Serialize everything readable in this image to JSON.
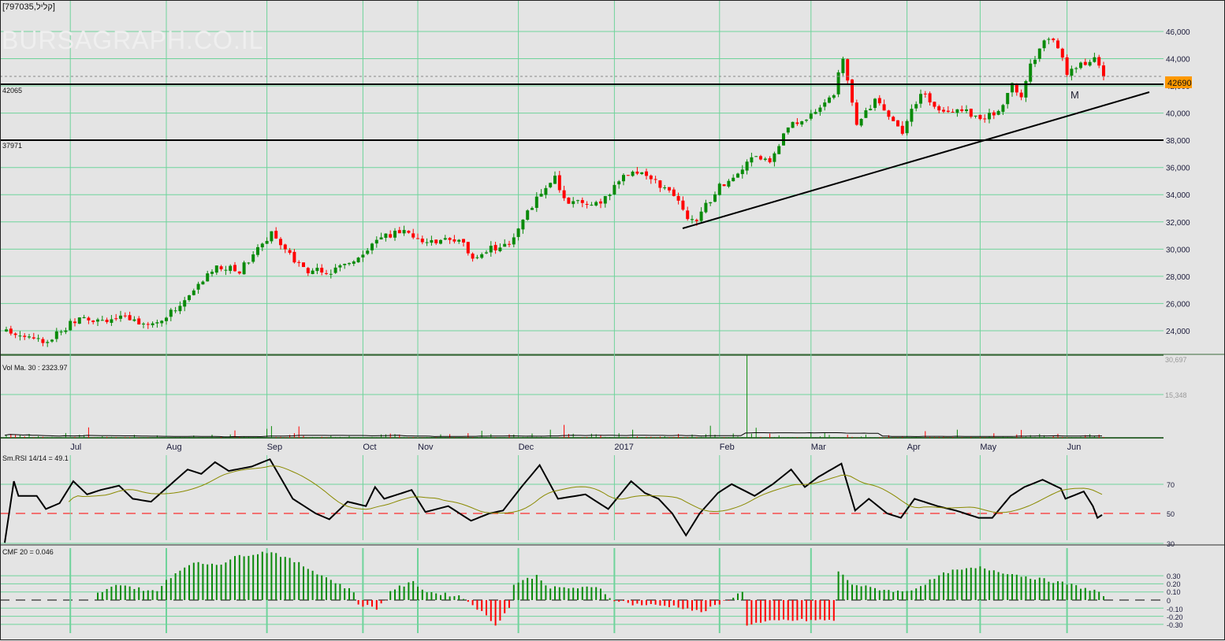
{
  "header": {
    "title": "[797035,קליל]",
    "watermark": "BURSAGRAPH.CO.IL"
  },
  "levels": {
    "resistance_label": "42065",
    "support_label": "37971",
    "last_price": "42690",
    "pattern_label": "M"
  },
  "colors": {
    "up": "#0a8a0a",
    "down": "#ff0000",
    "grid": "#6fd39b",
    "last": "#ff9900",
    "rsi_ma": "#8a8a00"
  },
  "panels": {
    "volume": {
      "label": "Vol Ma. 30 : 2323.97",
      "ticks": [
        "30,697",
        "15,348"
      ]
    },
    "rsi": {
      "label": "Sm.RSI 14/14 = 49.1",
      "ticks": [
        "70",
        "50",
        "30"
      ]
    },
    "cmf": {
      "label": "CMF 20 = 0.046",
      "ticks": [
        "0.30",
        "0.20",
        "0.10",
        "0",
        "-0.10",
        "-0.20",
        "-0.30"
      ]
    }
  },
  "months": [
    "Jul",
    "Aug",
    "Sep",
    "Oct",
    "Nov",
    "Dec",
    "2017",
    "Feb",
    "Mar",
    "Apr",
    "May",
    "Jun"
  ],
  "chart_data": {
    "type": "candlestick",
    "ylim": [
      23000,
      47000
    ],
    "price_ticks": [
      "46,000",
      "44,000",
      "42,000",
      "40,000",
      "38,000",
      "36,000",
      "34,000",
      "32,000",
      "30,000",
      "28,000",
      "26,000",
      "24,000"
    ],
    "price_tick_values": [
      46000,
      44000,
      42000,
      40000,
      38000,
      36000,
      34000,
      32000,
      30000,
      28000,
      26000,
      24000
    ],
    "month_bar_index": [
      14,
      35,
      57,
      78,
      90,
      112,
      133,
      156,
      176,
      197,
      213,
      232
    ],
    "close_anchors": [
      [
        0,
        24100
      ],
      [
        9,
        23200
      ],
      [
        15,
        24800
      ],
      [
        25,
        24900
      ],
      [
        33,
        24500
      ],
      [
        39,
        26200
      ],
      [
        46,
        28800
      ],
      [
        51,
        28400
      ],
      [
        58,
        31200
      ],
      [
        65,
        28500
      ],
      [
        71,
        28300
      ],
      [
        75,
        29000
      ],
      [
        81,
        30600
      ],
      [
        87,
        31500
      ],
      [
        92,
        30500
      ],
      [
        99,
        30800
      ],
      [
        102,
        29500
      ],
      [
        110,
        30500
      ],
      [
        113,
        32200
      ],
      [
        118,
        34700
      ],
      [
        120,
        35300
      ],
      [
        122,
        33500
      ],
      [
        130,
        33200
      ],
      [
        135,
        35500
      ],
      [
        139,
        35800
      ],
      [
        142,
        35000
      ],
      [
        147,
        33500
      ],
      [
        149,
        32000
      ],
      [
        151,
        32200
      ],
      [
        156,
        34600
      ],
      [
        161,
        36000
      ],
      [
        164,
        37000
      ],
      [
        167,
        36300
      ],
      [
        171,
        39000
      ],
      [
        176,
        39800
      ],
      [
        181,
        41500
      ],
      [
        183,
        44000
      ],
      [
        186,
        39200
      ],
      [
        190,
        41000
      ],
      [
        194,
        39500
      ],
      [
        196,
        38700
      ],
      [
        200,
        41600
      ],
      [
        204,
        40300
      ],
      [
        209,
        40300
      ],
      [
        213,
        39600
      ],
      [
        217,
        40000
      ],
      [
        220,
        42200
      ],
      [
        222,
        41000
      ],
      [
        224,
        43500
      ],
      [
        227,
        45400
      ],
      [
        230,
        45000
      ],
      [
        232,
        43000
      ],
      [
        236,
        43700
      ],
      [
        238,
        44300
      ],
      [
        240,
        42690
      ]
    ],
    "volume_spike": {
      "bar": 162,
      "value": 30697
    },
    "rsi_anchors": [
      [
        0,
        30
      ],
      [
        2,
        72
      ],
      [
        3,
        62
      ],
      [
        7,
        62
      ],
      [
        9,
        53
      ],
      [
        12,
        57
      ],
      [
        15,
        72
      ],
      [
        18,
        63
      ],
      [
        21,
        66
      ],
      [
        25,
        69
      ],
      [
        28,
        60
      ],
      [
        32,
        58
      ],
      [
        36,
        69
      ],
      [
        40,
        80
      ],
      [
        43,
        77
      ],
      [
        46,
        85
      ],
      [
        49,
        79
      ],
      [
        54,
        82
      ],
      [
        58,
        87
      ],
      [
        63,
        60
      ],
      [
        68,
        50
      ],
      [
        71,
        46
      ],
      [
        75,
        58
      ],
      [
        79,
        55
      ],
      [
        81,
        68
      ],
      [
        83,
        60
      ],
      [
        89,
        66
      ],
      [
        92,
        51
      ],
      [
        97,
        55
      ],
      [
        102,
        45
      ],
      [
        106,
        50
      ],
      [
        109,
        52
      ],
      [
        113,
        68
      ],
      [
        117,
        83
      ],
      [
        121,
        60
      ],
      [
        127,
        63
      ],
      [
        132,
        53
      ],
      [
        137,
        72
      ],
      [
        140,
        64
      ],
      [
        143,
        60
      ],
      [
        146,
        50
      ],
      [
        149,
        35
      ],
      [
        152,
        50
      ],
      [
        156,
        64
      ],
      [
        159,
        70
      ],
      [
        164,
        62
      ],
      [
        168,
        70
      ],
      [
        172,
        80
      ],
      [
        175,
        68
      ],
      [
        178,
        75
      ],
      [
        183,
        84
      ],
      [
        186,
        52
      ],
      [
        189,
        60
      ],
      [
        193,
        50
      ],
      [
        196,
        47
      ],
      [
        199,
        60
      ],
      [
        204,
        55
      ],
      [
        208,
        52
      ],
      [
        213,
        47
      ],
      [
        216,
        47
      ],
      [
        220,
        62
      ],
      [
        223,
        68
      ],
      [
        227,
        73
      ],
      [
        231,
        67
      ],
      [
        232,
        60
      ],
      [
        236,
        65
      ],
      [
        238,
        55
      ],
      [
        239,
        47
      ],
      [
        240,
        49
      ]
    ],
    "cmf_anchors": [
      [
        20,
        0.08
      ],
      [
        25,
        0.2
      ],
      [
        28,
        0.15
      ],
      [
        33,
        0.1
      ],
      [
        35,
        0.25
      ],
      [
        40,
        0.45
      ],
      [
        47,
        0.45
      ],
      [
        51,
        0.55
      ],
      [
        58,
        0.6
      ],
      [
        64,
        0.45
      ],
      [
        71,
        0.25
      ],
      [
        76,
        0.1
      ],
      [
        77,
        -0.05
      ],
      [
        81,
        -0.1
      ],
      [
        83,
        0
      ],
      [
        84,
        0.12
      ],
      [
        89,
        0.22
      ],
      [
        92,
        0.1
      ],
      [
        99,
        0.05
      ],
      [
        102,
        -0.05
      ],
      [
        107,
        -0.3
      ],
      [
        110,
        -0.1
      ],
      [
        111,
        0.2
      ],
      [
        116,
        0.3
      ],
      [
        119,
        0.15
      ],
      [
        130,
        0.15
      ],
      [
        132,
        0.02
      ],
      [
        137,
        -0.05
      ],
      [
        147,
        -0.08
      ],
      [
        152,
        -0.15
      ],
      [
        156,
        -0.05
      ],
      [
        161,
        0.1
      ],
      [
        162,
        -0.3
      ],
      [
        170,
        -0.25
      ],
      [
        181,
        -0.25
      ],
      [
        182,
        0.35
      ],
      [
        185,
        0.2
      ],
      [
        189,
        0.15
      ],
      [
        196,
        0.1
      ],
      [
        199,
        0.15
      ],
      [
        206,
        0.35
      ],
      [
        213,
        0.4
      ],
      [
        222,
        0.3
      ],
      [
        227,
        0.25
      ],
      [
        232,
        0.2
      ],
      [
        239,
        0.1
      ],
      [
        240,
        0.05
      ]
    ]
  }
}
